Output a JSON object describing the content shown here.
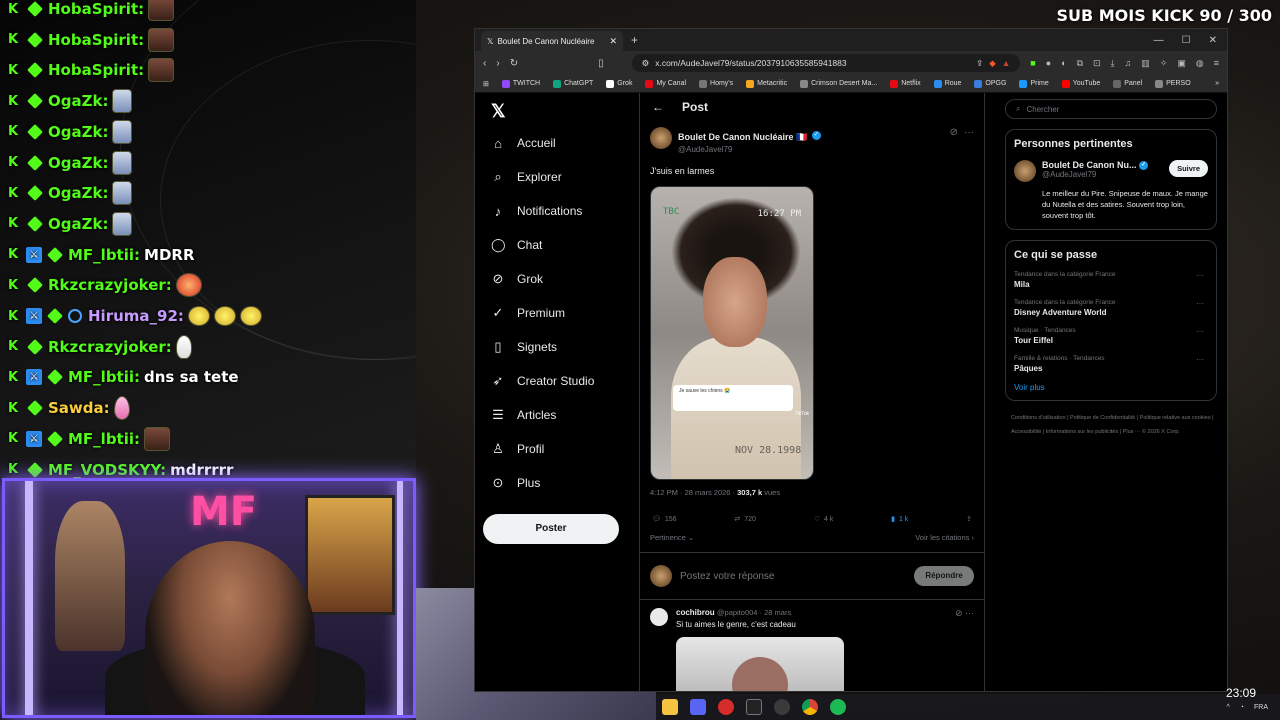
{
  "sub_goal": "SUB MOIS KICK 90 / 300",
  "chat": [
    {
      "user": "HobaSpirit",
      "text": "",
      "user_color": "green",
      "emote": "brown",
      "mod": false,
      "vip": false
    },
    {
      "user": "HobaSpirit",
      "text": "",
      "user_color": "green",
      "emote": "brown",
      "mod": false,
      "vip": false
    },
    {
      "user": "HobaSpirit",
      "text": "",
      "user_color": "green",
      "emote": "brown",
      "mod": false,
      "vip": false
    },
    {
      "user": "OgaZk",
      "text": "",
      "user_color": "green",
      "emote": "blue",
      "mod": false,
      "vip": false
    },
    {
      "user": "OgaZk",
      "text": "",
      "user_color": "green",
      "emote": "blue",
      "mod": false,
      "vip": false
    },
    {
      "user": "OgaZk",
      "text": "",
      "user_color": "green",
      "emote": "blue",
      "mod": false,
      "vip": false
    },
    {
      "user": "OgaZk",
      "text": "",
      "user_color": "green",
      "emote": "blue",
      "mod": false,
      "vip": false
    },
    {
      "user": "OgaZk",
      "text": "",
      "user_color": "green",
      "emote": "blue",
      "mod": false,
      "vip": false
    },
    {
      "user": "MF_lbtii",
      "text": "MDRR",
      "user_color": "green",
      "emote": "",
      "mod": true,
      "vip": false
    },
    {
      "user": "Rkzcrazyjoker",
      "text": "",
      "user_color": "green",
      "emote": "clown",
      "mod": false,
      "vip": false
    },
    {
      "user": "Hiruma_92",
      "text": "",
      "user_color": "purple",
      "emote": "yellow3",
      "mod": true,
      "vip": true
    },
    {
      "user": "Rkzcrazyjoker",
      "text": "",
      "user_color": "green",
      "emote": "goose",
      "mod": false,
      "vip": false
    },
    {
      "user": "MF_lbtii",
      "text": "dns sa tete",
      "user_color": "green",
      "emote": "",
      "mod": true,
      "vip": false
    },
    {
      "user": "Sawda",
      "text": "",
      "user_color": "yellow",
      "emote": "drop",
      "mod": false,
      "vip": false
    },
    {
      "user": "MF_lbtii",
      "text": "",
      "user_color": "green",
      "emote": "brown",
      "mod": true,
      "vip": false
    },
    {
      "user": "MF_VODSKYY",
      "text": "mdrrrrr",
      "user_color": "green",
      "emote": "",
      "mod": false,
      "vip": false
    }
  ],
  "browser": {
    "tab_title": "Boulet De Canon Nucléaire",
    "url": "x.com/AudeJavel79/status/2037910635585941883",
    "bookmarks": [
      "TWITCH",
      "ChatGPT",
      "Grok",
      "My Canal",
      "Homy's",
      "Metacritic",
      "Crimson Desert Ma...",
      "Netflix",
      "Roue",
      "OPGG",
      "Prime",
      "YouTube",
      "Panel",
      "PERSO"
    ]
  },
  "x": {
    "nav": [
      {
        "label": "Accueil",
        "icon": "home-icon"
      },
      {
        "label": "Explorer",
        "icon": "search-icon"
      },
      {
        "label": "Notifications",
        "icon": "bell-icon"
      },
      {
        "label": "Chat",
        "icon": "chat-icon"
      },
      {
        "label": "Grok",
        "icon": "grok-icon"
      },
      {
        "label": "Premium",
        "icon": "premium-icon"
      },
      {
        "label": "Signets",
        "icon": "bookmark-icon"
      },
      {
        "label": "Creator Studio",
        "icon": "rocket-icon"
      },
      {
        "label": "Articles",
        "icon": "articles-icon"
      },
      {
        "label": "Profil",
        "icon": "profile-icon"
      },
      {
        "label": "Plus",
        "icon": "more-icon"
      }
    ],
    "post_button": "Poster",
    "header": "Post",
    "tweet": {
      "name": "Boulet De Canon Nucléaire 🇫🇷",
      "handle": "@AudeJavel79",
      "text": "J'suis en larmes",
      "media_time": "16:27 PM",
      "media_tbc": "TBC",
      "media_comment": "Je sauve les chiens 😭",
      "media_date": "NOV 28.1998",
      "media_tiktok": "TikTok",
      "time": "4:12 PM · 28 mars 2026 · ",
      "views": "303,7 k",
      "views_label": " vues",
      "replies": "156",
      "retweets": "720",
      "likes": "4 k",
      "bookmarks": "1 k",
      "sort_label": "Pertinence",
      "quotes_label": "Voir les citations"
    },
    "reply_placeholder": "Postez votre réponse",
    "reply_button": "Répondre",
    "comment": {
      "name": "cochibrou",
      "meta": "@papito004 · 28 mars",
      "text": "Si tu aimes le genre, c'est cadeau"
    },
    "search_placeholder": "Chercher",
    "relevant": {
      "title": "Personnes pertinentes",
      "name": "Boulet De Canon Nu...",
      "handle": "@AudeJavel79",
      "follow": "Suivre",
      "bio": "Le meilleur du Pire. Snipeuse de maux. Je mange du Nutella et des satires. Souvent trop loin, souvent trop tôt."
    },
    "trends": {
      "title": "Ce qui se passe",
      "items": [
        {
          "cat": "Tendance dans la catégorie France",
          "name": "Mila"
        },
        {
          "cat": "Tendance dans la catégorie France",
          "name": "Disney Adventure World"
        },
        {
          "cat": "Musique · Tendances",
          "name": "Tour Eiffel"
        },
        {
          "cat": "Famille & relations · Tendances",
          "name": "Pâques"
        }
      ],
      "more": "Voir plus"
    },
    "footer": "Conditions d'utilisation  |  Politique de Confidentialité  |  Politique relative aux cookies  |  Accessibilité  |  Informations sur les publicités  |  Plus ···  © 2026 X Corp."
  },
  "taskbar": {
    "lang": "FRA",
    "clock": "23:09"
  }
}
